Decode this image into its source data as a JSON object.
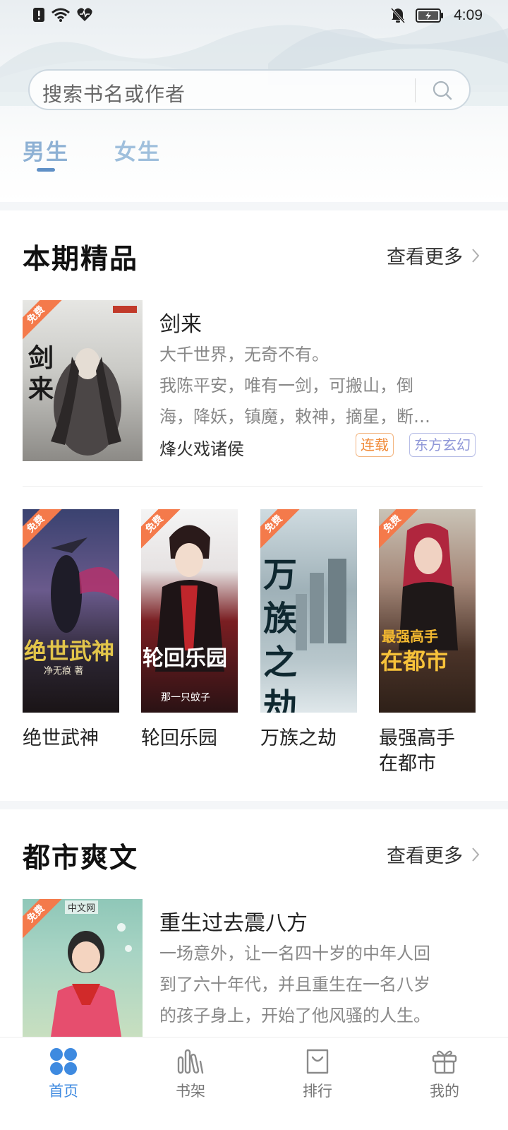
{
  "status_bar": {
    "time": "4:09"
  },
  "search": {
    "placeholder": "搜索书名或作者"
  },
  "gender_tabs": [
    {
      "label": "男生",
      "active": true
    },
    {
      "label": "女生",
      "active": false
    }
  ],
  "sections": [
    {
      "title": "本期精品",
      "see_more": "查看更多",
      "featured": {
        "title": "剑来",
        "desc_line1": "大千世界，无奇不有。",
        "desc_line2": "我陈平安，唯有一剑，可搬山，倒",
        "desc_line3": "海，降妖，镇魔，敕神，摘星，断…",
        "author": "烽火戏诸侯",
        "tags": [
          "连载",
          "东方玄幻"
        ],
        "badge": "免费",
        "cover_text": "剑来"
      },
      "grid": [
        {
          "title": "绝世武神",
          "badge": "免费",
          "cover_text": "绝世武神",
          "cover_sub": "净无痕 著"
        },
        {
          "title": "轮回乐园",
          "badge": "免费",
          "cover_text": "轮回乐园",
          "cover_sub": "那一只蚊子"
        },
        {
          "title": "万族之劫",
          "badge": "免费",
          "cover_text": "万族之劫",
          "cover_sub": ""
        },
        {
          "title_line1": "最强高手",
          "title_line2": "在都市",
          "badge": "免费",
          "cover_text": "最强高手",
          "cover_text2": "在都市"
        }
      ]
    },
    {
      "title": "都市爽文",
      "see_more": "查看更多",
      "featured": {
        "title": "重生过去震八方",
        "desc_line1": "一场意外，让一名四十岁的中年人回",
        "desc_line2": "到了六十年代，并且重生在一名八岁",
        "desc_line3": "的孩子身上，开始了他风骚的人生。",
        "badge": "免费",
        "cover_text": "中文网"
      }
    }
  ],
  "bottom_nav": [
    {
      "label": "首页",
      "icon": "home-grid-icon",
      "active": true
    },
    {
      "label": "书架",
      "icon": "bookshelf-icon",
      "active": false
    },
    {
      "label": "排行",
      "icon": "ranking-bag-icon",
      "active": false
    },
    {
      "label": "我的",
      "icon": "gift-icon",
      "active": false
    }
  ],
  "colors": {
    "accent": "#3e8ae0",
    "free_badge": "#f47a4b",
    "tab_text": "#9fbfdc"
  }
}
